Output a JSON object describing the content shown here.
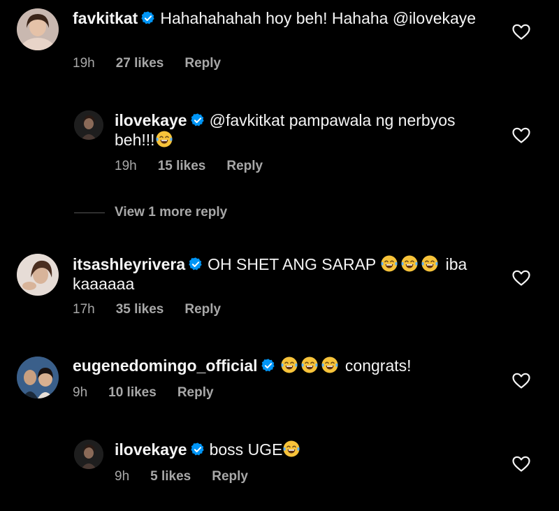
{
  "comments": [
    {
      "username": "favkitkat",
      "text": "Hahahahahah hoy beh! Hahaha @ilovekaye",
      "time": "19h",
      "likes": "27 likes",
      "reply": "Reply"
    },
    {
      "username": "ilovekaye",
      "text_before": "@favkitkat pampawala ng nerbyos beh!!!",
      "time": "19h",
      "likes": "15 likes",
      "reply": "Reply"
    },
    {
      "username": "itsashleyrivera",
      "text_before": "OH SHET ANG SARAP",
      "text_after": "iba kaaaaaa",
      "time": "17h",
      "likes": "35 likes",
      "reply": "Reply"
    },
    {
      "username": "eugenedomingo_official",
      "text_after": "congrats!",
      "time": "9h",
      "likes": "10 likes",
      "reply": "Reply"
    },
    {
      "username": "ilovekaye",
      "text_before": "boss UGE",
      "time": "9h",
      "likes": "5 likes",
      "reply": "Reply"
    }
  ],
  "view_more": "View 1 more reply",
  "colors": {
    "background": "#000000",
    "text": "#f5f5f5",
    "muted": "#a8a8a8",
    "verified": "#0095f6"
  },
  "icons": {
    "verified": "verified-badge-icon",
    "like": "heart-outline-icon",
    "emoji": "face-with-tears-of-joy-emoji"
  }
}
